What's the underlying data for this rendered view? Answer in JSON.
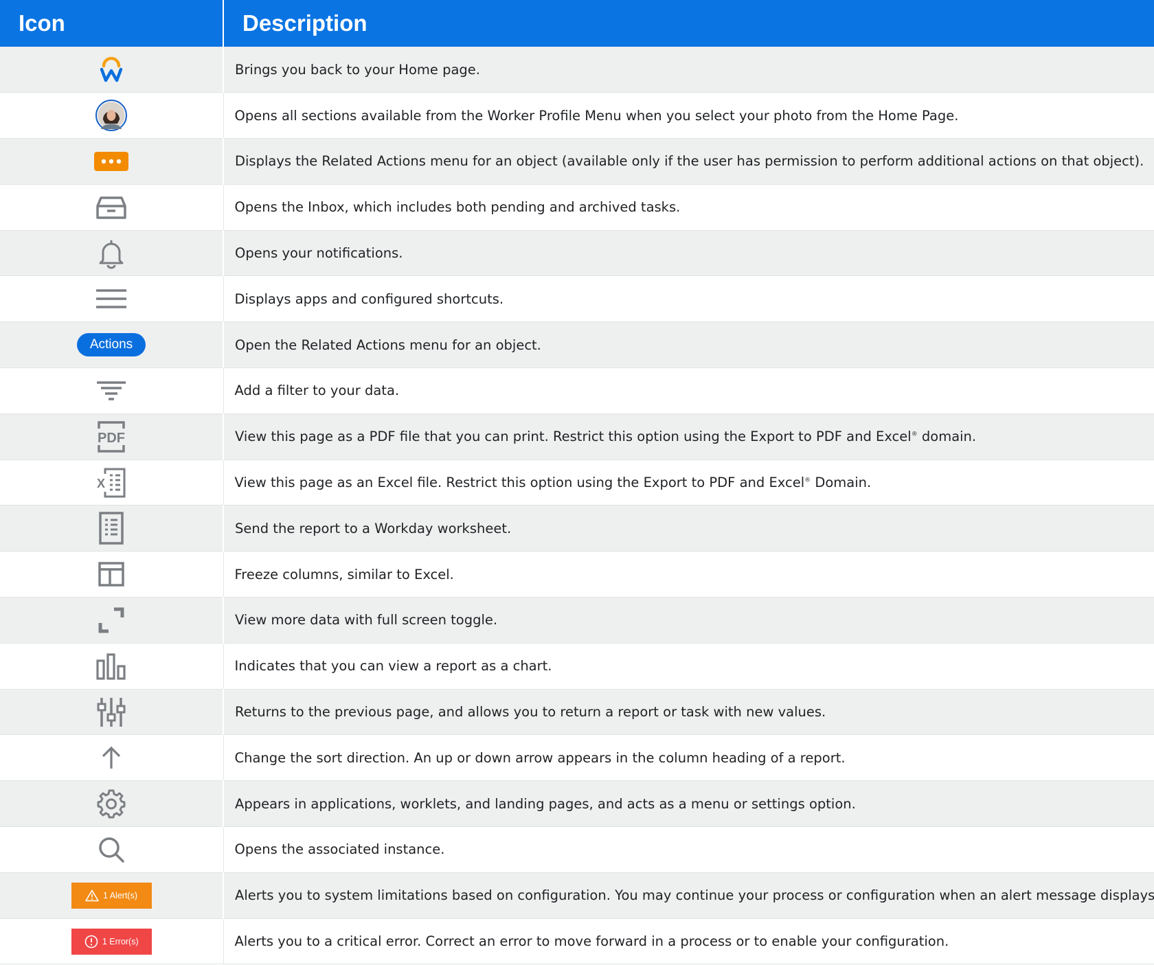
{
  "header": {
    "icon_col": "Icon",
    "description_col": "Description"
  },
  "rows": [
    {
      "icon": "workday-home-logo-icon",
      "description": "Brings you back to your Home page."
    },
    {
      "icon": "worker-profile-photo-icon",
      "description": "Opens all sections available from the Worker Profile Menu when you select your photo from the Home Page."
    },
    {
      "icon": "related-actions-ellipsis-icon",
      "description": "Displays the Related Actions menu for an object (available only if the user has permission to perform additional actions on that object)."
    },
    {
      "icon": "inbox-icon",
      "description": "Opens the Inbox, which includes both pending and archived tasks."
    },
    {
      "icon": "notifications-bell-icon",
      "description": "Opens your notifications."
    },
    {
      "icon": "menu-hamburger-icon",
      "description": "Displays apps and configured shortcuts."
    },
    {
      "icon": "actions-button",
      "label": "Actions",
      "description": "Open the Related Actions menu for an object."
    },
    {
      "icon": "filter-icon",
      "description": "Add a filter to your data."
    },
    {
      "icon": "pdf-export-icon",
      "description_parts": [
        "View this page as a PDF file that you can print.  Restrict this option using the Export to PDF and Excel",
        "®",
        " domain."
      ]
    },
    {
      "icon": "excel-export-icon",
      "description_parts": [
        "View this page as an Excel file. Restrict this option using the Export to PDF and Excel",
        "®",
        " Domain."
      ]
    },
    {
      "icon": "worksheet-icon",
      "description": "Send the report to a Workday worksheet."
    },
    {
      "icon": "freeze-columns-icon",
      "description": "Freeze columns, similar to Excel."
    },
    {
      "icon": "fullscreen-toggle-icon",
      "description": "View more data with full screen toggle."
    },
    {
      "icon": "chart-icon",
      "description": "Indicates that you can view a report as a chart."
    },
    {
      "icon": "filter-sliders-icon",
      "description": "Returns to the previous page, and allows you to return a report or task with new values."
    },
    {
      "icon": "sort-arrow-up-icon",
      "description": "Change the sort direction. An up or down arrow appears in the column heading of a report."
    },
    {
      "icon": "gear-icon",
      "description": "Appears in applications, worklets, and landing pages, and acts as a menu or settings option."
    },
    {
      "icon": "search-icon",
      "description": "Opens the associated instance."
    },
    {
      "icon": "alert-badge",
      "label": "1 Alert(s)",
      "description": "Alerts you to system limitations based on configuration. You may continue your process or configuration when an alert message displays."
    },
    {
      "icon": "error-badge",
      "label": "1 Error(s)",
      "description": "Alerts you to a critical error. Correct an error to move forward in a process or to enable your configuration."
    }
  ],
  "colors": {
    "header_bg": "#0a74e3",
    "row_alt_bg": "#eef0f0",
    "icon_gray": "#7b7f83",
    "ellipsis_orange": "#f38b00",
    "alert_orange": "#f28a14",
    "error_red": "#f04646",
    "actions_blue": "#0a6fde"
  }
}
